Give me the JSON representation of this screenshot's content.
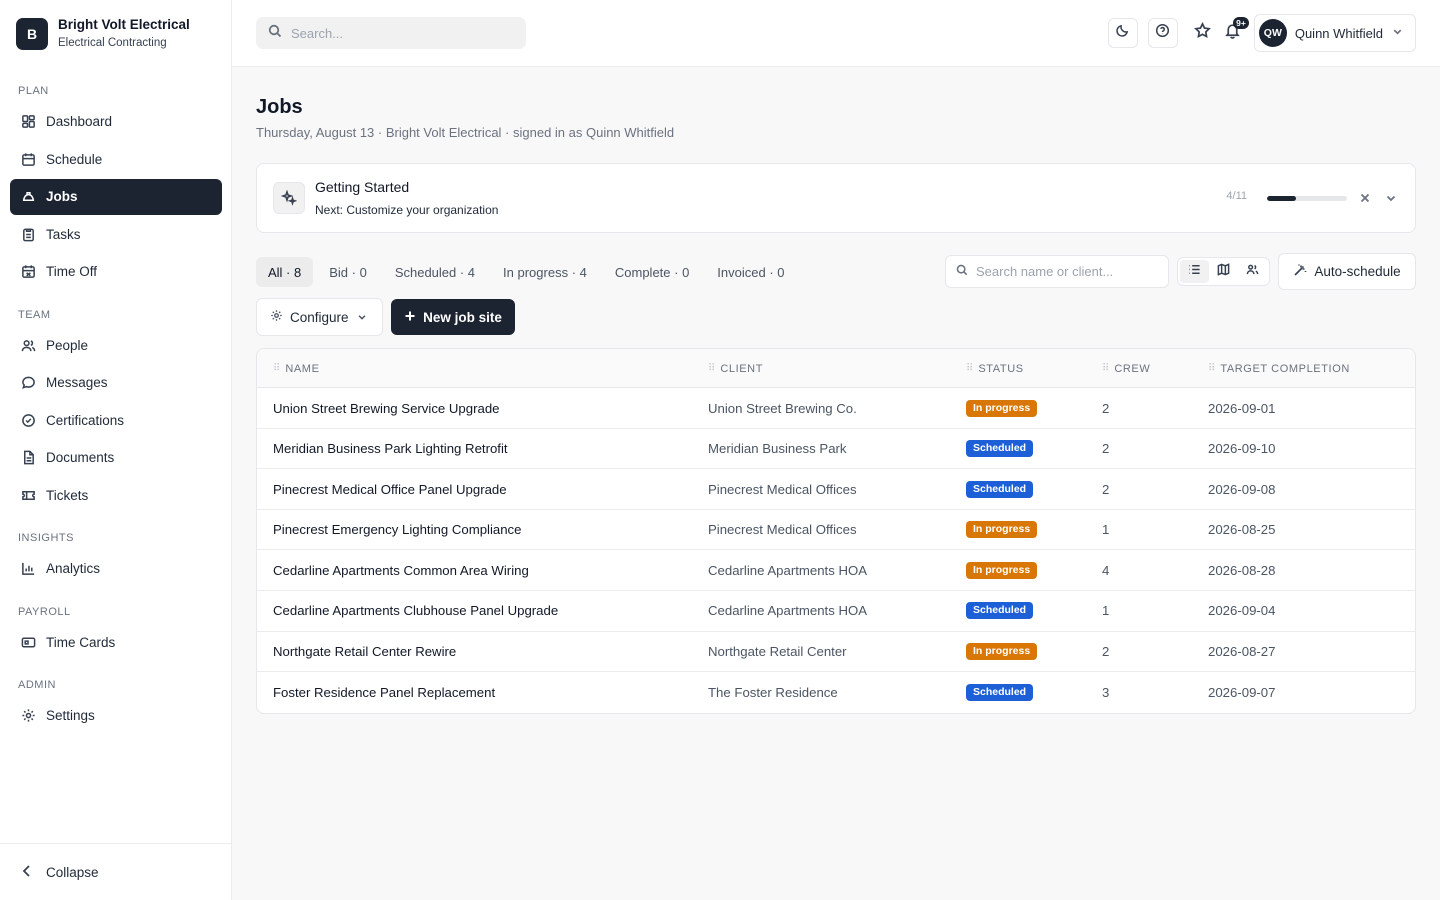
{
  "brand": {
    "logo_letter": "B",
    "name": "Bright Volt Electrical",
    "subtitle": "Electrical Contracting"
  },
  "sidebar": {
    "sections": [
      {
        "label": "PLAN",
        "items": [
          {
            "label": "Dashboard",
            "icon": "dashboard-icon"
          },
          {
            "label": "Schedule",
            "icon": "calendar-icon"
          },
          {
            "label": "Jobs",
            "icon": "hard-hat-icon",
            "active": true
          },
          {
            "label": "Tasks",
            "icon": "clipboard-icon"
          },
          {
            "label": "Time Off",
            "icon": "calendar-off-icon"
          }
        ]
      },
      {
        "label": "TEAM",
        "items": [
          {
            "label": "People",
            "icon": "users-icon"
          },
          {
            "label": "Messages",
            "icon": "message-icon"
          },
          {
            "label": "Certifications",
            "icon": "badge-check-icon"
          },
          {
            "label": "Documents",
            "icon": "document-icon"
          },
          {
            "label": "Tickets",
            "icon": "ticket-icon"
          }
        ]
      },
      {
        "label": "INSIGHTS",
        "items": [
          {
            "label": "Analytics",
            "icon": "bar-chart-icon"
          }
        ]
      },
      {
        "label": "PAYROLL",
        "items": [
          {
            "label": "Time Cards",
            "icon": "time-card-icon"
          }
        ]
      },
      {
        "label": "ADMIN",
        "items": [
          {
            "label": "Settings",
            "icon": "gear-icon"
          }
        ]
      }
    ],
    "collapse_label": "Collapse"
  },
  "topbar": {
    "search_placeholder": "Search...",
    "notification_count": "9+",
    "user": {
      "initials": "QW",
      "name": "Quinn Whitfield"
    }
  },
  "page": {
    "title": "Jobs",
    "subtitle": "Thursday, August 13 · Bright Volt Electrical · signed in as Quinn Whitfield"
  },
  "getting_started": {
    "title": "Getting Started",
    "next": "Next: Customize your organization",
    "progress_text": "4/11",
    "progress_fraction": 0.364
  },
  "filters": [
    {
      "label": "All · 8",
      "active": true
    },
    {
      "label": "Bid · 0"
    },
    {
      "label": "Scheduled · 4"
    },
    {
      "label": "In progress · 4"
    },
    {
      "label": "Complete · 0"
    },
    {
      "label": "Invoiced · 0"
    }
  ],
  "list_search_placeholder": "Search name or client...",
  "buttons": {
    "auto_schedule": "Auto-schedule",
    "configure": "Configure",
    "new_job_site": "New job site"
  },
  "table": {
    "columns": [
      "NAME",
      "CLIENT",
      "STATUS",
      "CREW",
      "TARGET COMPLETION"
    ],
    "rows": [
      {
        "name": "Union Street Brewing Service Upgrade",
        "client": "Union Street Brewing Co.",
        "status": "In progress",
        "crew": "2",
        "target": "2026-09-01"
      },
      {
        "name": "Meridian Business Park Lighting Retrofit",
        "client": "Meridian Business Park",
        "status": "Scheduled",
        "crew": "2",
        "target": "2026-09-10"
      },
      {
        "name": "Pinecrest Medical Office Panel Upgrade",
        "client": "Pinecrest Medical Offices",
        "status": "Scheduled",
        "crew": "2",
        "target": "2026-09-08"
      },
      {
        "name": "Pinecrest Emergency Lighting Compliance",
        "client": "Pinecrest Medical Offices",
        "status": "In progress",
        "crew": "1",
        "target": "2026-08-25"
      },
      {
        "name": "Cedarline Apartments Common Area Wiring",
        "client": "Cedarline Apartments HOA",
        "status": "In progress",
        "crew": "4",
        "target": "2026-08-28"
      },
      {
        "name": "Cedarline Apartments Clubhouse Panel Upgrade",
        "client": "Cedarline Apartments HOA",
        "status": "Scheduled",
        "crew": "1",
        "target": "2026-09-04"
      },
      {
        "name": "Northgate Retail Center Rewire",
        "client": "Northgate Retail Center",
        "status": "In progress",
        "crew": "2",
        "target": "2026-08-27"
      },
      {
        "name": "Foster Residence Panel Replacement",
        "client": "The Foster Residence",
        "status": "Scheduled",
        "crew": "3",
        "target": "2026-09-07"
      }
    ]
  }
}
